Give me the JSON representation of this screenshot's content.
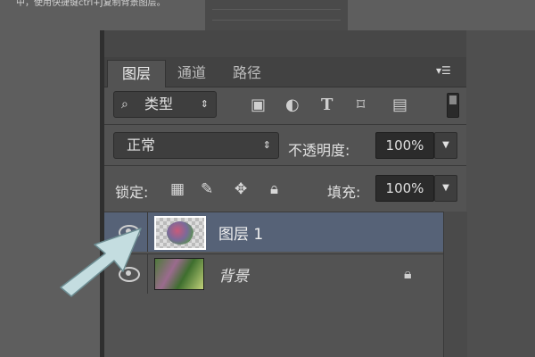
{
  "page": {
    "caption_text": "中，使用快捷键ctrl+J复制背景图层。"
  },
  "panel": {
    "tabs": [
      {
        "label": "图层",
        "active": true
      },
      {
        "label": "通道",
        "active": false
      },
      {
        "label": "路径",
        "active": false
      }
    ],
    "filter": {
      "kind_label": "类型",
      "icons": [
        "image-filter-icon",
        "adjustment-filter-icon",
        "type-filter-icon",
        "shape-filter-icon",
        "smart-object-filter-icon"
      ]
    },
    "blend": {
      "mode": "正常",
      "opacity_label": "不透明度:",
      "opacity_value": "100%"
    },
    "lock": {
      "label": "锁定:",
      "icons": [
        "lock-transparent-pixels-icon",
        "lock-image-pixels-icon",
        "lock-position-icon",
        "lock-all-icon"
      ],
      "fill_label": "填充:",
      "fill_value": "100%"
    },
    "layers": [
      {
        "name": "图层 1",
        "selected": true,
        "visible": true,
        "locked": false
      },
      {
        "name": "背景",
        "selected": false,
        "visible": true,
        "locked": true
      }
    ]
  },
  "colors": {
    "panel_bg": "#535353",
    "selected_row": "#566277",
    "arrow": "#c4dde0"
  }
}
